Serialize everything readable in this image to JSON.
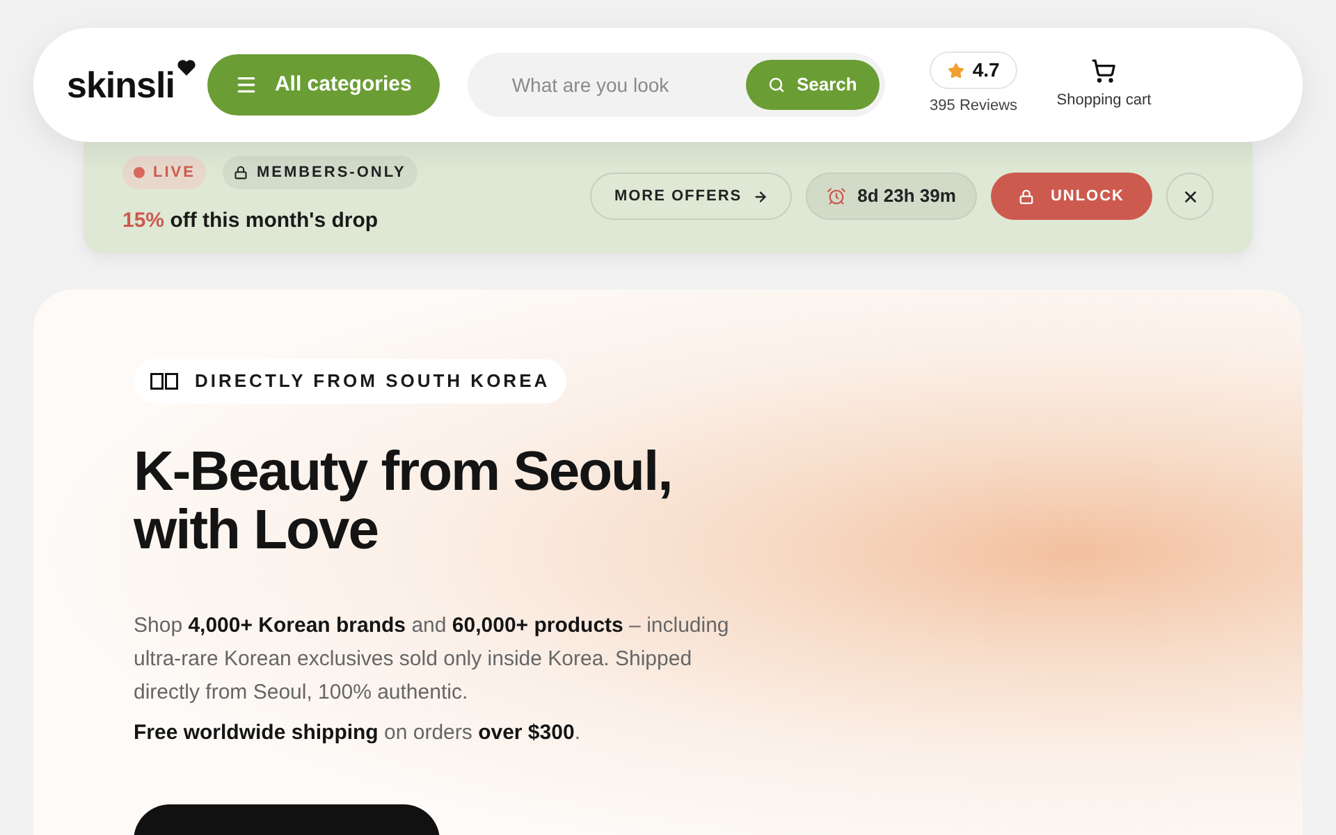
{
  "header": {
    "logo": "skinsli",
    "categories_button": "All categories",
    "search": {
      "placeholder": "What are you look",
      "button": "Search"
    },
    "rating": {
      "score": "4.7",
      "reviews": "395 Reviews"
    },
    "cart": "Shopping cart"
  },
  "offer_bar": {
    "badges": [
      {
        "kind": "live",
        "label": "LIVE"
      },
      {
        "kind": "lock",
        "label": "MEMBERS-ONLY"
      }
    ],
    "discount": "15%",
    "headline": "off this month's drop",
    "more_button": "MORE OFFERS",
    "countdown": "8d 23h 39m",
    "unlock_button": "UNLOCK"
  },
  "hero": {
    "tag": "DIRECTLY FROM SOUTH KOREA",
    "title": "K-Beauty from Seoul, with Love",
    "description": "Shop **4,000+ Korean brands** and **60,000+ products** – including ultra-rare Korean exclusives sold only inside Korea. Shipped directly from Seoul, 100% authentic.",
    "shipping": "**Free worldwide shipping** on orders **over $300**."
  }
}
